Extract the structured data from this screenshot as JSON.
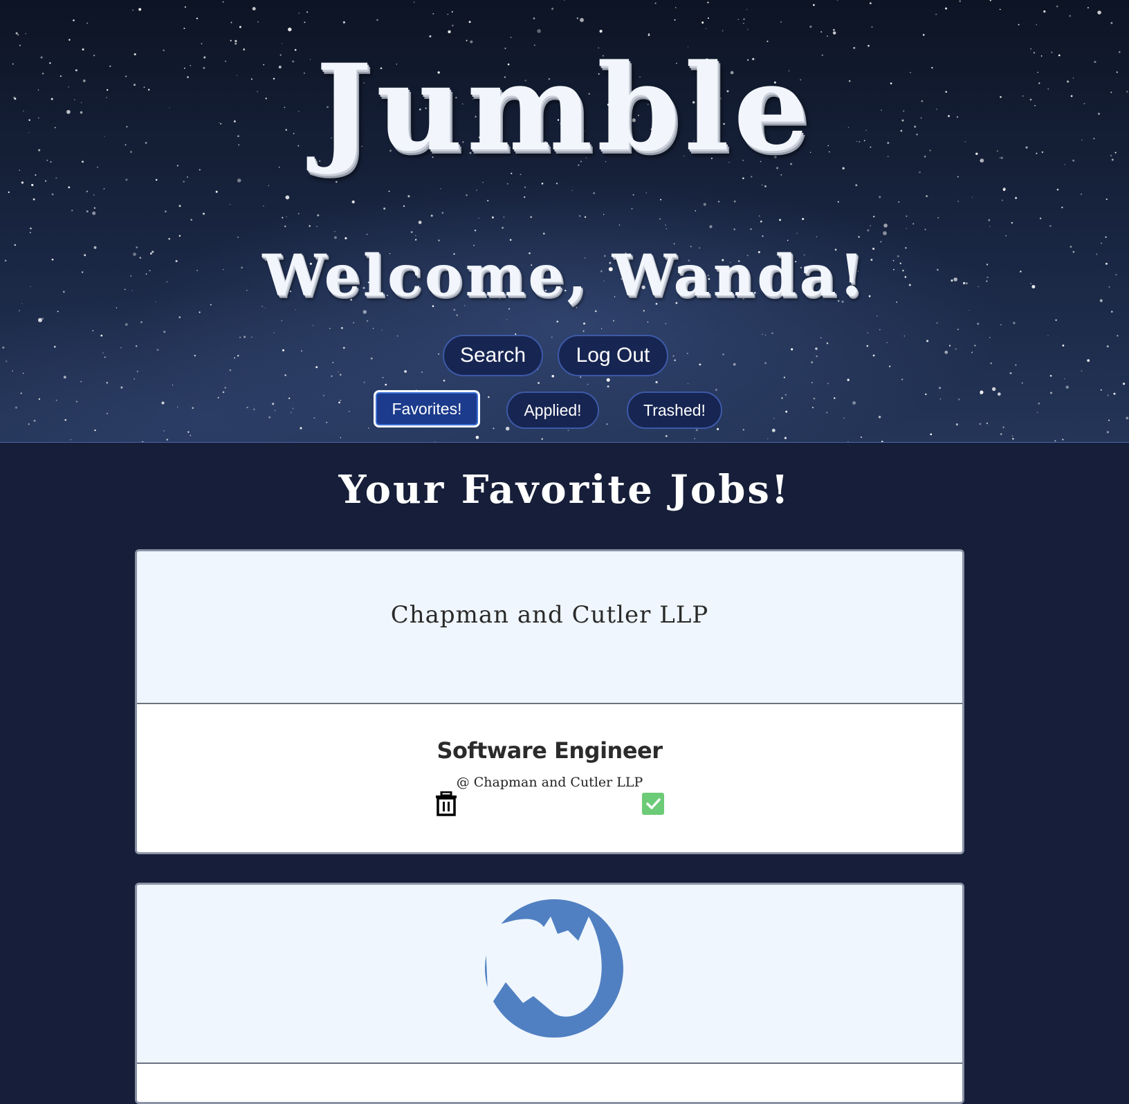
{
  "header": {
    "app_title": "Jumble",
    "welcome": "Welcome, Wanda!"
  },
  "nav": {
    "search_label": "Search",
    "logout_label": "Log Out"
  },
  "tabs": [
    {
      "label": "Favorites!",
      "active": true
    },
    {
      "label": "Applied!",
      "active": false
    },
    {
      "label": "Trashed!",
      "active": false
    }
  ],
  "main": {
    "section_title": "Your Favorite Jobs!",
    "jobs": [
      {
        "header_company": "Chapman and Cutler LLP",
        "title": "Software Engineer",
        "company_line": "@ Chapman and Cutler LLP",
        "actions": {
          "trash_icon": "trash-icon",
          "apply_icon": "check-icon"
        }
      },
      {
        "logo_icon": "rhino-logo",
        "logo_color": "#5080c2"
      }
    ]
  },
  "colors": {
    "page_background": "#161e39",
    "button_background": "#172552",
    "button_border": "#3d5aa8",
    "card_header": "#eff6fd",
    "check_green": "#6ccb76"
  }
}
